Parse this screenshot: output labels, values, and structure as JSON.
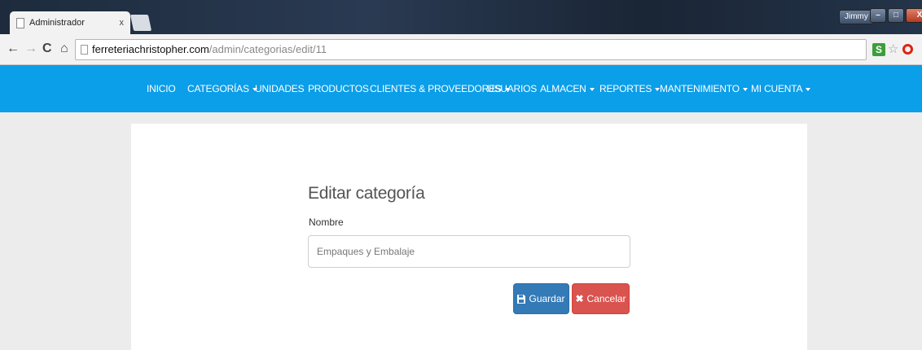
{
  "browser": {
    "tab_title": "Administrador",
    "tab_close": "x",
    "window_user": "Jimmy",
    "window_controls": {
      "minimize": "–",
      "maximize": "□",
      "close": "X"
    },
    "url_host": "ferreteriachristopher.com",
    "url_path": "/admin/categorias/edit/11",
    "extension_label": "S",
    "icons": {
      "back": "←",
      "forward": "→",
      "reload": "C",
      "home": "⌂",
      "star": "☆",
      "menu": "⋮"
    }
  },
  "navbar": {
    "background": "#0b9ee9",
    "items": [
      {
        "label": "INICIO",
        "dropdown": false
      },
      {
        "label": "CATEGORÍAS",
        "dropdown": true
      },
      {
        "label": "UNIDADES",
        "dropdown": false
      },
      {
        "label": "PRODUCTOS",
        "dropdown": false
      },
      {
        "label": "CLIENTES & PROVEEDORES",
        "dropdown": true
      },
      {
        "label": "USUARIOS",
        "dropdown": false
      },
      {
        "label": "ALMACEN",
        "dropdown": true
      },
      {
        "label": "REPORTES",
        "dropdown": true
      },
      {
        "label": "MANTENIMIENTO",
        "dropdown": true
      },
      {
        "label": "MI CUENTA",
        "dropdown": true
      }
    ]
  },
  "form": {
    "title": "Editar categoría",
    "name_label": "Nombre",
    "name_value": "Empaques y Embalaje",
    "save_label": "Guardar",
    "cancel_label": "Cancelar"
  },
  "colors": {
    "primary": "#337ab7",
    "danger": "#d9534f"
  }
}
